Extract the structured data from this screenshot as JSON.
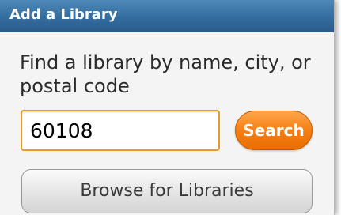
{
  "dialog": {
    "title": "Add a Library",
    "prompt": "Find a library by name, city, or postal code",
    "search": {
      "value": "60108",
      "button_label": "Search"
    },
    "browse_label": "Browse for Libraries"
  },
  "colors": {
    "titlebar": "#336d9f",
    "search_button": "#f57f14",
    "input_border": "#e99a26"
  }
}
